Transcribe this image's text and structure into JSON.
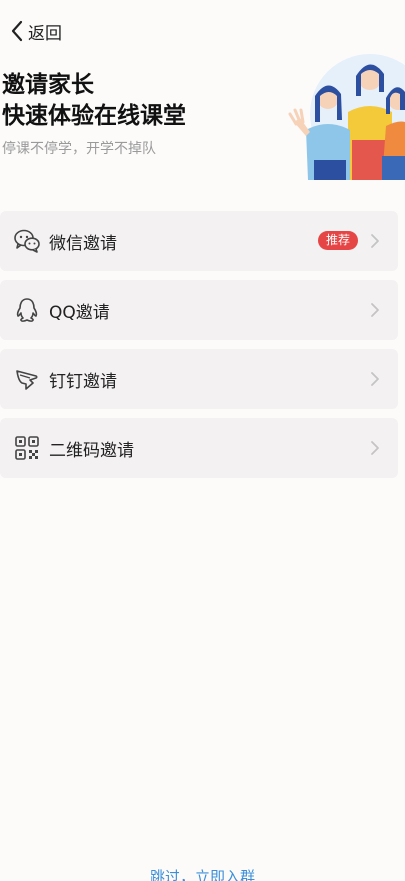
{
  "nav": {
    "back_label": "返回"
  },
  "hero": {
    "title_line1": "邀请家长",
    "title_line2": "快速体验在线课堂",
    "subtitle": "停课不停学，开学不掉队"
  },
  "invite_options": [
    {
      "label": "微信邀请",
      "icon": "wechat-icon",
      "badge": "推荐"
    },
    {
      "label": "QQ邀请",
      "icon": "qq-icon"
    },
    {
      "label": "钉钉邀请",
      "icon": "dingtalk-icon"
    },
    {
      "label": "二维码邀请",
      "icon": "qrcode-icon"
    }
  ],
  "footer": {
    "skip_label": "跳过，立即入群"
  },
  "colors": {
    "accent": "#3b8fd9",
    "badge": "#e64545",
    "card": "#f3f1f1"
  }
}
